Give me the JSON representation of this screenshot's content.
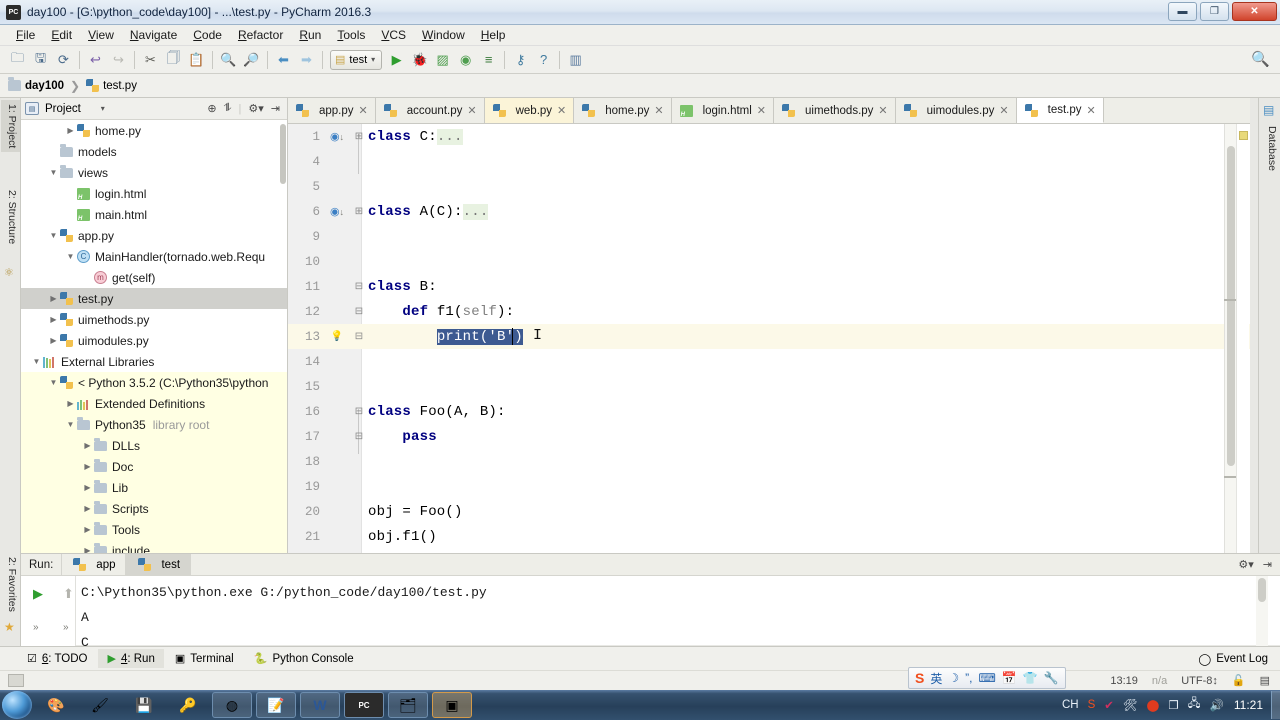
{
  "window": {
    "title": "day100 - [G:\\python_code\\day100] - ...\\test.py - PyCharm 2016.3",
    "app_icon": "PC",
    "minimize": "—",
    "maximize": "❐",
    "close": "✕"
  },
  "menubar": [
    "File",
    "Edit",
    "View",
    "Navigate",
    "Code",
    "Refactor",
    "Run",
    "Tools",
    "VCS",
    "Window",
    "Help"
  ],
  "toolbar": {
    "buttons": [
      {
        "name": "open-folder-icon",
        "glyph": "🗀"
      },
      {
        "name": "save-all-icon",
        "glyph": "🖫"
      },
      {
        "name": "sync-icon",
        "glyph": "⟳"
      },
      {
        "name": "undo-icon",
        "glyph": "↩"
      },
      {
        "name": "redo-icon",
        "glyph": "↪"
      },
      {
        "name": "cut-icon",
        "glyph": "✄"
      },
      {
        "name": "copy-icon",
        "glyph": "🗍"
      },
      {
        "name": "paste-icon",
        "glyph": "📋"
      },
      {
        "name": "find-icon",
        "glyph": "🔍"
      },
      {
        "name": "replace-icon",
        "glyph": "🔎"
      },
      {
        "name": "back-icon",
        "glyph": "⬅"
      },
      {
        "name": "forward-icon",
        "glyph": "➡"
      }
    ],
    "run_config": "test",
    "run_config_caret": "▾",
    "run_buttons": [
      {
        "name": "run-icon",
        "glyph": "▶"
      },
      {
        "name": "debug-icon",
        "glyph": "🐞"
      },
      {
        "name": "coverage-icon",
        "glyph": "▨"
      },
      {
        "name": "profile-icon",
        "glyph": "◉"
      },
      {
        "name": "attach-icon",
        "glyph": "≡"
      },
      {
        "name": "settings-icon",
        "glyph": "⚙"
      },
      {
        "name": "help-icon",
        "glyph": "?"
      },
      {
        "name": "database-icon",
        "glyph": "▤"
      }
    ],
    "search_everywhere": "🔍"
  },
  "breadcrumb": [
    {
      "label": "day100",
      "icon": "folder-icon",
      "bold": true
    },
    {
      "label": "test.py",
      "icon": "python-file-icon",
      "bold": false
    }
  ],
  "left_tool_strip": [
    {
      "label": "1: Project",
      "selected": true
    },
    {
      "label": "2: Structure",
      "selected": false
    }
  ],
  "bottom_left_strip": [
    {
      "label": "2: Favorites"
    }
  ],
  "right_tool_strip": [
    {
      "label": "Database"
    }
  ],
  "project_panel": {
    "title": "Project",
    "dropdown_caret": "▾",
    "actions": [
      "target-icon",
      "collapse-all-icon",
      "settings-icon",
      "hide-icon"
    ],
    "tree": [
      {
        "indent": 2,
        "arrow": "▶",
        "icon": "python-file-icon",
        "label": "home.py",
        "state": "normal"
      },
      {
        "indent": 1,
        "arrow": "",
        "icon": "folder-icon",
        "label": "models",
        "state": "normal"
      },
      {
        "indent": 1,
        "arrow": "▼",
        "icon": "folder-icon",
        "label": "views",
        "state": "normal"
      },
      {
        "indent": 2,
        "arrow": "",
        "icon": "html-file-icon",
        "label": "login.html",
        "state": "normal"
      },
      {
        "indent": 2,
        "arrow": "",
        "icon": "html-file-icon",
        "label": "main.html",
        "state": "normal"
      },
      {
        "indent": 1,
        "arrow": "▼",
        "icon": "python-file-icon",
        "label": "app.py",
        "state": "normal"
      },
      {
        "indent": 2,
        "arrow": "▼",
        "icon": "class-icon",
        "label": "MainHandler(tornado.web.Requ",
        "state": "normal"
      },
      {
        "indent": 3,
        "arrow": "",
        "icon": "method-icon",
        "label": "get(self)",
        "state": "normal"
      },
      {
        "indent": 1,
        "arrow": "▶",
        "icon": "python-file-icon",
        "label": "test.py",
        "state": "selected"
      },
      {
        "indent": 1,
        "arrow": "▶",
        "icon": "python-file-icon",
        "label": "uimethods.py",
        "state": "normal"
      },
      {
        "indent": 1,
        "arrow": "▶",
        "icon": "python-file-icon",
        "label": "uimodules.py",
        "state": "normal"
      },
      {
        "indent": 0,
        "arrow": "▼",
        "icon": "library-icon",
        "label": "External Libraries",
        "state": "normal"
      },
      {
        "indent": 1,
        "arrow": "▼",
        "icon": "python-file-icon",
        "label": "< Python 3.5.2 (C:\\Python35\\python",
        "state": "library"
      },
      {
        "indent": 2,
        "arrow": "▶",
        "icon": "library-icon",
        "label": "Extended Definitions",
        "state": "library"
      },
      {
        "indent": 2,
        "arrow": "▼",
        "icon": "folder-icon",
        "label": "Python35",
        "sub": "library root",
        "state": "library"
      },
      {
        "indent": 3,
        "arrow": "▶",
        "icon": "folder-icon",
        "label": "DLLs",
        "state": "library"
      },
      {
        "indent": 3,
        "arrow": "▶",
        "icon": "folder-icon",
        "label": "Doc",
        "state": "library"
      },
      {
        "indent": 3,
        "arrow": "▶",
        "icon": "folder-icon",
        "label": "Lib",
        "state": "library"
      },
      {
        "indent": 3,
        "arrow": "▶",
        "icon": "folder-icon",
        "label": "Scripts",
        "state": "library"
      },
      {
        "indent": 3,
        "arrow": "▶",
        "icon": "folder-icon",
        "label": "Tools",
        "state": "library"
      },
      {
        "indent": 3,
        "arrow": "▶",
        "icon": "folder-icon",
        "label": "include",
        "state": "library"
      }
    ]
  },
  "editor": {
    "tabs": [
      {
        "label": "app.py",
        "icon": "python-file-icon",
        "active": false,
        "highlight": false
      },
      {
        "label": "account.py",
        "icon": "python-file-icon",
        "active": false,
        "highlight": false
      },
      {
        "label": "web.py",
        "icon": "python-file-icon",
        "active": false,
        "highlight": true
      },
      {
        "label": "home.py",
        "icon": "python-file-icon",
        "active": false,
        "highlight": false
      },
      {
        "label": "login.html",
        "icon": "html-file-icon",
        "active": false,
        "highlight": false
      },
      {
        "label": "uimethods.py",
        "icon": "python-file-icon",
        "active": false,
        "highlight": false
      },
      {
        "label": "uimodules.py",
        "icon": "python-file-icon",
        "active": false,
        "highlight": false
      },
      {
        "label": "test.py",
        "icon": "python-file-icon",
        "active": true,
        "highlight": false
      }
    ],
    "close_glyph": "✕",
    "lines": [
      {
        "num": "1",
        "gutter": "override-icon",
        "fold": "⊞",
        "current": false,
        "tokens": [
          {
            "t": "class ",
            "c": "kw"
          },
          {
            "t": "C:",
            "c": "cls"
          },
          {
            "t": "...",
            "c": "fold-el"
          }
        ]
      },
      {
        "num": "4",
        "gutter": "",
        "fold": "",
        "current": false,
        "tokens": []
      },
      {
        "num": "5",
        "gutter": "",
        "fold": "",
        "current": false,
        "tokens": []
      },
      {
        "num": "6",
        "gutter": "override-icon",
        "fold": "⊞",
        "current": false,
        "tokens": [
          {
            "t": "class ",
            "c": "kw"
          },
          {
            "t": "A(C):",
            "c": "cls"
          },
          {
            "t": "...",
            "c": "fold-el"
          }
        ]
      },
      {
        "num": "9",
        "gutter": "",
        "fold": "",
        "current": false,
        "tokens": []
      },
      {
        "num": "10",
        "gutter": "",
        "fold": "",
        "current": false,
        "tokens": []
      },
      {
        "num": "11",
        "gutter": "",
        "fold": "⊟",
        "current": false,
        "tokens": [
          {
            "t": "class ",
            "c": "kw"
          },
          {
            "t": "B:",
            "c": "cls"
          }
        ]
      },
      {
        "num": "12",
        "gutter": "",
        "fold": "⊟",
        "current": false,
        "tokens": [
          {
            "t": "    ",
            "c": "cls"
          },
          {
            "t": "def ",
            "c": "kw"
          },
          {
            "t": "f1(",
            "c": "fn"
          },
          {
            "t": "self",
            "c": "param"
          },
          {
            "t": "):",
            "c": "fn"
          }
        ]
      },
      {
        "num": "13",
        "gutter": "intention-bulb-icon",
        "fold": "⊟",
        "current": true,
        "selected_text": "print('B')"
      },
      {
        "num": "14",
        "gutter": "",
        "fold": "",
        "current": false,
        "tokens": []
      },
      {
        "num": "15",
        "gutter": "",
        "fold": "",
        "current": false,
        "tokens": []
      },
      {
        "num": "16",
        "gutter": "",
        "fold": "⊟",
        "current": false,
        "tokens": [
          {
            "t": "class ",
            "c": "kw"
          },
          {
            "t": "Foo(A, B):",
            "c": "cls"
          }
        ]
      },
      {
        "num": "17",
        "gutter": "",
        "fold": "⊟",
        "current": false,
        "tokens": [
          {
            "t": "    ",
            "c": "cls"
          },
          {
            "t": "pass",
            "c": "kw"
          }
        ]
      },
      {
        "num": "18",
        "gutter": "",
        "fold": "",
        "current": false,
        "tokens": []
      },
      {
        "num": "19",
        "gutter": "",
        "fold": "",
        "current": false,
        "tokens": []
      },
      {
        "num": "20",
        "gutter": "",
        "fold": "",
        "current": false,
        "tokens": [
          {
            "t": "obj = Foo()",
            "c": "cls"
          }
        ]
      },
      {
        "num": "21",
        "gutter": "",
        "fold": "",
        "current": false,
        "tokens": [
          {
            "t": "obj.f1()",
            "c": "cls"
          }
        ]
      }
    ]
  },
  "run_window": {
    "label": "Run:",
    "tabs": [
      {
        "label": "app",
        "icon": "python-file-icon",
        "active": false
      },
      {
        "label": "test",
        "icon": "python-file-icon",
        "active": true
      }
    ],
    "header_actions": [
      "settings-icon",
      "hide-icon"
    ],
    "side_buttons": [
      {
        "name": "rerun-icon",
        "glyph": "▶"
      },
      {
        "name": "scroll-up-icon",
        "glyph": "⬆"
      },
      {
        "name": "expand-left-icon",
        "glyph": "»"
      },
      {
        "name": "expand-right-icon",
        "glyph": "»"
      }
    ],
    "console": [
      "C:\\Python35\\python.exe G:/python_code/day100/test.py",
      "A",
      "C"
    ]
  },
  "status_bar": {
    "items": [
      {
        "label": "Python Console",
        "icon": "python-icon",
        "active": false,
        "underline": ""
      },
      {
        "label": "Terminal",
        "icon": "terminal-icon",
        "active": false,
        "underline": ""
      },
      {
        "label": "4: Run",
        "icon": "run-icon",
        "active": true,
        "underline": "4"
      },
      {
        "label": "6: TODO",
        "icon": "todo-icon",
        "active": false,
        "underline": "6"
      }
    ],
    "event_log": "Event Log",
    "event_log_icon": "bell-icon"
  },
  "status_bar2": {
    "time": "13:19",
    "na": "n/a",
    "encoding": "UTF-8↕",
    "lock_icon": "🔓",
    "hide_icon": "▤"
  },
  "ime_bar": {
    "logo": "S",
    "items": [
      {
        "name": "chinese-mode-icon",
        "glyph": "英"
      },
      {
        "name": "moon-icon",
        "glyph": "☽"
      },
      {
        "name": "punctuation-icon",
        "glyph": "”,"
      },
      {
        "name": "keyboard-icon",
        "glyph": "⌨"
      },
      {
        "name": "calendar-icon",
        "glyph": "📅"
      },
      {
        "name": "skin-icon",
        "glyph": "👕"
      },
      {
        "name": "tools-icon",
        "glyph": "🔧"
      }
    ]
  },
  "taskbar": {
    "start": "start-orb",
    "items": [
      {
        "name": "taskbar-paint-icon",
        "glyph": "🎨",
        "style": "plain"
      },
      {
        "name": "taskbar-colors-icon",
        "glyph": "🖌",
        "style": "plain"
      },
      {
        "name": "taskbar-save-icon",
        "glyph": "💾",
        "style": "plain"
      },
      {
        "name": "taskbar-tool-icon",
        "glyph": "🔑",
        "style": "plain"
      },
      {
        "name": "taskbar-chrome-icon",
        "glyph": "◍",
        "style": "box"
      },
      {
        "name": "taskbar-notepad-icon",
        "glyph": "📝",
        "style": "box"
      },
      {
        "name": "taskbar-word-icon",
        "glyph": "W",
        "style": "box"
      },
      {
        "name": "taskbar-pycharm-icon",
        "glyph": "PC",
        "style": "box"
      },
      {
        "name": "taskbar-explorer-icon",
        "glyph": "🗂",
        "style": "box"
      },
      {
        "name": "taskbar-media-icon",
        "glyph": "▣",
        "style": "active"
      }
    ],
    "tray": [
      {
        "name": "tray-ime-icon",
        "glyph": "CH"
      },
      {
        "name": "tray-sogou-icon",
        "glyph": "S"
      },
      {
        "name": "tray-shield-icon",
        "glyph": "✔"
      },
      {
        "name": "tray-tools-icon",
        "glyph": "🛠"
      },
      {
        "name": "tray-record-icon",
        "glyph": "⬤"
      },
      {
        "name": "tray-window-icon",
        "glyph": "❐"
      },
      {
        "name": "tray-network-icon",
        "glyph": "🖧"
      },
      {
        "name": "tray-volume-icon",
        "glyph": "🔊"
      }
    ],
    "clock": "11:21"
  }
}
